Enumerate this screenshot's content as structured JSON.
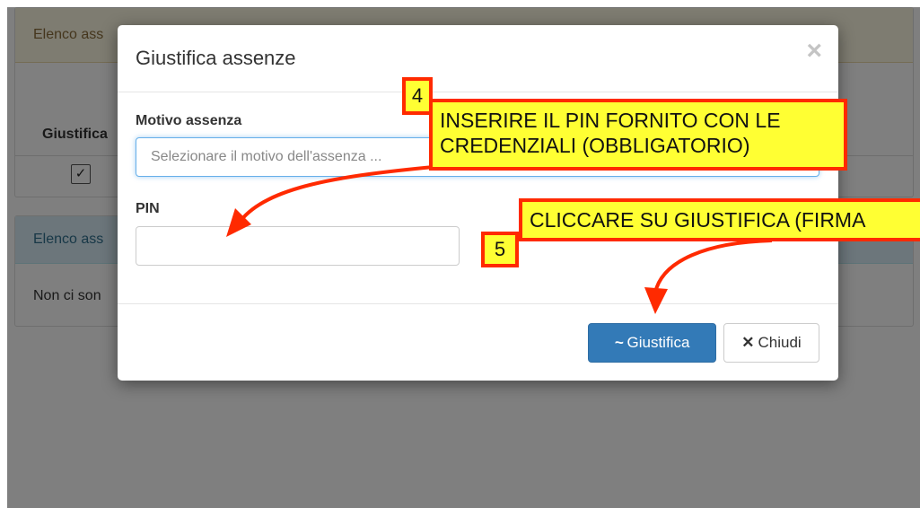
{
  "background": {
    "panel1_heading": "Elenco ass",
    "column_header": "Giustifica",
    "checkbox_mark": "✓",
    "panel2_heading": "Elenco ass",
    "panel2_text": "Non ci son"
  },
  "modal": {
    "title": "Giustifica assenze",
    "close_glyph": "×",
    "motivo_label": "Motivo assenza",
    "motivo_placeholder": "Selezionare il motivo dell'assenza ...",
    "pin_label": "PIN",
    "pin_value": "",
    "giustifica_icon": "~",
    "giustifica_label": "Giustifica",
    "chiudi_icon": "✕",
    "chiudi_label": "Chiudi"
  },
  "annotations": {
    "step4_number": "4",
    "step4_line1": "INSERIRE IL PIN FORNITO CON LE",
    "step4_line2": "CREDENZIALI (OBBLIGATORIO)",
    "step5_number": "5",
    "step5_text": "CLICCARE SU GIUSTIFICA (FIRMA",
    "callout_fill": "#ffff33",
    "callout_border": "#ff2a00"
  },
  "colors": {
    "primary": "#337ab7",
    "warning_bg": "#fcf8e3",
    "info_bg": "#d9edf7"
  }
}
